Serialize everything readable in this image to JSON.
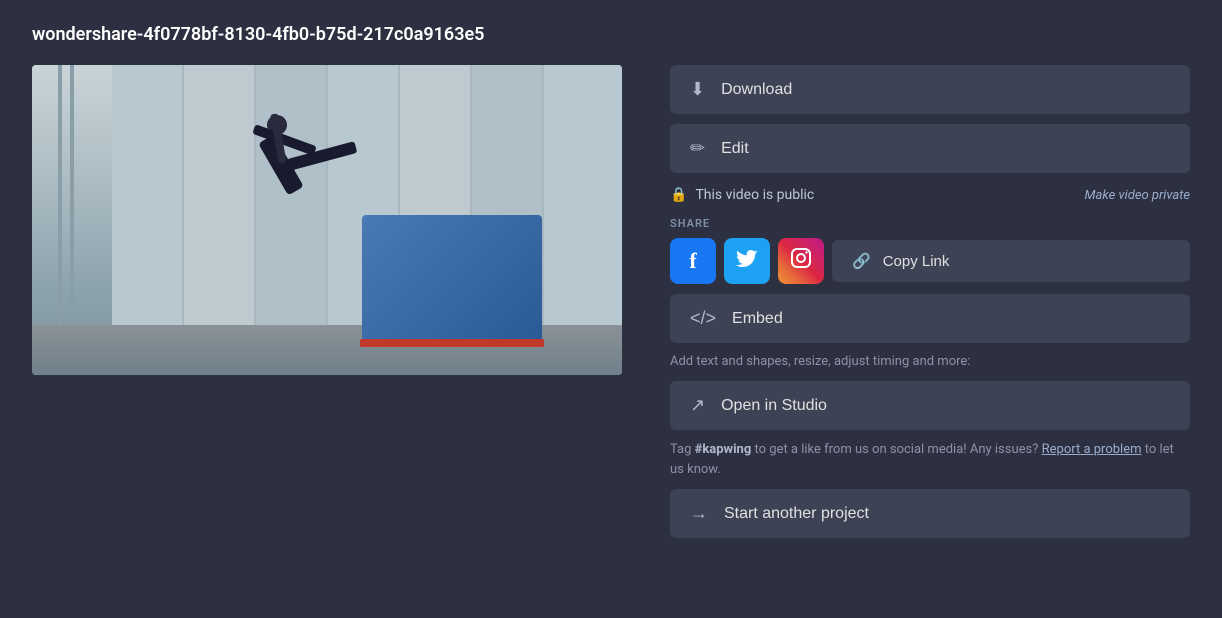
{
  "page": {
    "title": "wondershare-4f0778bf-8130-4fb0-b75d-217c0a9163e5"
  },
  "buttons": {
    "download": "Download",
    "edit": "Edit",
    "embed": "Embed",
    "copy_link": "Copy Link",
    "open_in_studio": "Open in Studio",
    "start_another_project": "Start another project"
  },
  "visibility": {
    "label": "This video is public",
    "make_private": "Make video private"
  },
  "share": {
    "section_label": "SHARE",
    "facebook_label": "f",
    "twitter_label": "t",
    "instagram_label": "ig"
  },
  "studio": {
    "helper_text": "Add text and shapes, resize, adjust timing and more:"
  },
  "social_tag": {
    "text_before": "Tag ",
    "tag": "#kapwing",
    "text_middle": " to get a like from us on social media! Any issues? ",
    "report_link": "Report a problem",
    "text_after": " to let us know."
  }
}
